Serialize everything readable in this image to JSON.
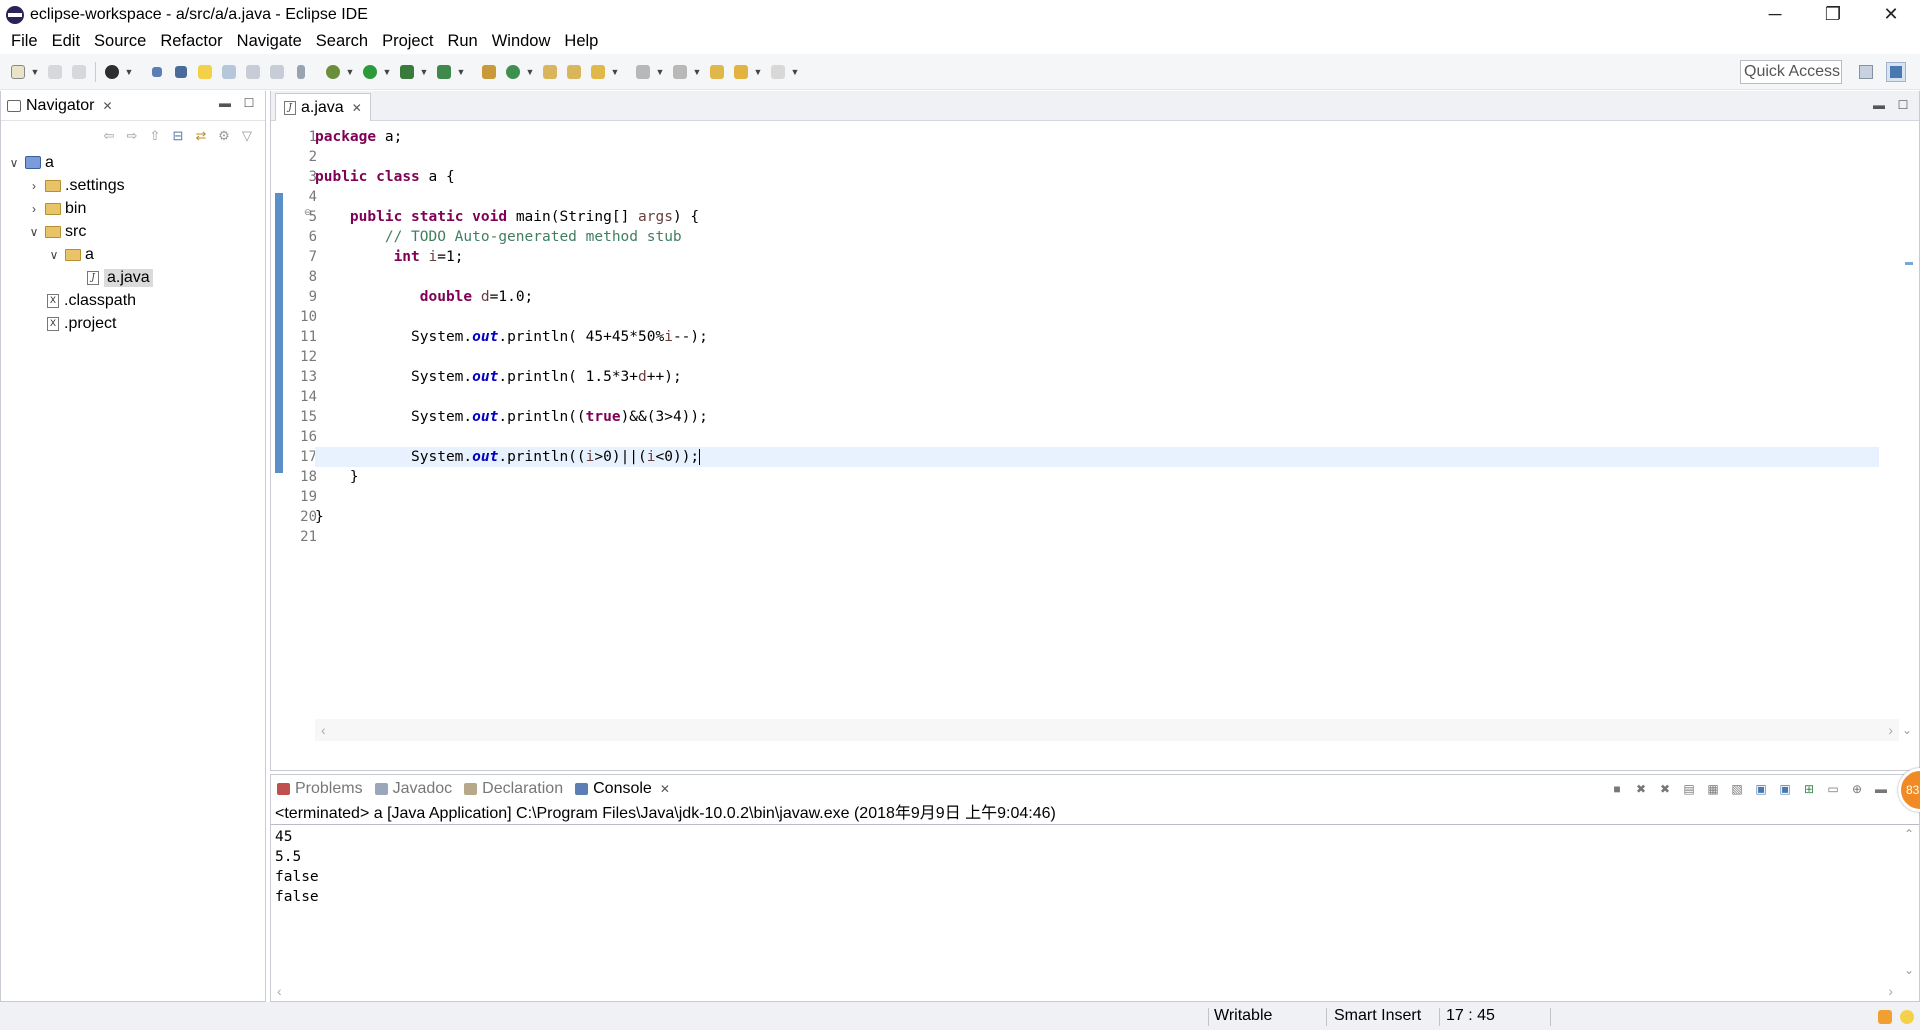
{
  "window": {
    "title": "eclipse-workspace - a/src/a/a.java - Eclipse IDE",
    "minimize": "─",
    "restore": "❐",
    "close": "✕"
  },
  "menu": [
    "File",
    "Edit",
    "Source",
    "Refactor",
    "Navigate",
    "Search",
    "Project",
    "Run",
    "Window",
    "Help"
  ],
  "toolbar": {
    "quick_access": "Quick Access"
  },
  "navigator": {
    "tab_label": "Navigator",
    "tree": [
      {
        "label": "a",
        "type": "project",
        "twisty": "∨",
        "indent": 0
      },
      {
        "label": ".settings",
        "type": "folder",
        "twisty": "›",
        "indent": 1
      },
      {
        "label": "bin",
        "type": "folder",
        "twisty": "›",
        "indent": 1
      },
      {
        "label": "src",
        "type": "folder",
        "twisty": "∨",
        "indent": 1
      },
      {
        "label": "a",
        "type": "folder",
        "twisty": "∨",
        "indent": 2
      },
      {
        "label": "a.java",
        "type": "java",
        "twisty": "",
        "indent": 3,
        "selected": true
      },
      {
        "label": ".classpath",
        "type": "file",
        "twisty": "",
        "indent": 1
      },
      {
        "label": ".project",
        "type": "file",
        "twisty": "",
        "indent": 1
      }
    ]
  },
  "editor": {
    "tab_label": "a.java",
    "line_numbers": [
      "1",
      "2",
      "3",
      "4",
      "5",
      "6",
      "7",
      "8",
      "9",
      "10",
      "11",
      "12",
      "13",
      "14",
      "15",
      "16",
      "17",
      "18",
      "19",
      "20",
      "21"
    ],
    "fold_marker": "⊖",
    "code_lines": [
      [
        {
          "t": "package",
          "c": "kw"
        },
        {
          "t": " a;",
          "c": ""
        }
      ],
      [],
      [
        {
          "t": "public",
          "c": "kw"
        },
        {
          "t": " ",
          "c": ""
        },
        {
          "t": "class",
          "c": "kw"
        },
        {
          "t": " a {",
          "c": ""
        }
      ],
      [],
      [
        {
          "t": "    ",
          "c": ""
        },
        {
          "t": "public",
          "c": "kw"
        },
        {
          "t": " ",
          "c": ""
        },
        {
          "t": "static",
          "c": "kw"
        },
        {
          "t": " ",
          "c": ""
        },
        {
          "t": "void",
          "c": "kw"
        },
        {
          "t": " main(String[] ",
          "c": ""
        },
        {
          "t": "args",
          "c": "vr"
        },
        {
          "t": ") {",
          "c": ""
        }
      ],
      [
        {
          "t": "        ",
          "c": ""
        },
        {
          "t": "// TODO Auto-generated method stub",
          "c": "cm"
        }
      ],
      [
        {
          "t": "         ",
          "c": ""
        },
        {
          "t": "int",
          "c": "kw"
        },
        {
          "t": " ",
          "c": ""
        },
        {
          "t": "i",
          "c": "vr"
        },
        {
          "t": "=1;",
          "c": ""
        }
      ],
      [],
      [
        {
          "t": "            ",
          "c": ""
        },
        {
          "t": "double",
          "c": "kw"
        },
        {
          "t": " ",
          "c": ""
        },
        {
          "t": "d",
          "c": "vr"
        },
        {
          "t": "=1.0;",
          "c": ""
        }
      ],
      [],
      [
        {
          "t": "           System.",
          "c": ""
        },
        {
          "t": "out",
          "c": "fld"
        },
        {
          "t": ".println( 45+45*50%",
          "c": ""
        },
        {
          "t": "i",
          "c": "vr"
        },
        {
          "t": "--);",
          "c": ""
        }
      ],
      [],
      [
        {
          "t": "           System.",
          "c": ""
        },
        {
          "t": "out",
          "c": "fld"
        },
        {
          "t": ".println( 1.5*3+",
          "c": ""
        },
        {
          "t": "d",
          "c": "vr"
        },
        {
          "t": "++);",
          "c": ""
        }
      ],
      [],
      [
        {
          "t": "           System.",
          "c": ""
        },
        {
          "t": "out",
          "c": "fld"
        },
        {
          "t": ".println((",
          "c": ""
        },
        {
          "t": "true",
          "c": "kw"
        },
        {
          "t": ")&&(3>4));",
          "c": ""
        }
      ],
      [],
      [
        {
          "t": "           System.",
          "c": ""
        },
        {
          "t": "out",
          "c": "fld"
        },
        {
          "t": ".println((",
          "c": ""
        },
        {
          "t": "i",
          "c": "vr"
        },
        {
          "t": ">0)||(",
          "c": ""
        },
        {
          "t": "i",
          "c": "vr"
        },
        {
          "t": "<0));",
          "c": ""
        }
      ],
      [
        {
          "t": "    }",
          "c": ""
        }
      ],
      [],
      [
        {
          "t": "}",
          "c": ""
        }
      ],
      []
    ],
    "current_line_index": 16
  },
  "console": {
    "tabs": [
      {
        "label": "Problems",
        "active": false,
        "color": "#c0504d"
      },
      {
        "label": "Javadoc",
        "active": false,
        "color": "#9aa7b8"
      },
      {
        "label": "Declaration",
        "active": false,
        "color": "#b8a88a"
      },
      {
        "label": "Console",
        "active": true,
        "color": "#5b7fb4"
      }
    ],
    "status": "<terminated> a [Java Application] C:\\Program Files\\Java\\jdk-10.0.2\\bin\\javaw.exe (2018年9月9日 上午9:04:46)",
    "output": [
      "45",
      "5.5",
      "false",
      "false"
    ],
    "badge": "83"
  },
  "statusbar": {
    "writable": "Writable",
    "insert_mode": "Smart Insert",
    "position": "17 : 45"
  },
  "colors": {
    "keyword": "#7f0055",
    "comment": "#3f7f5f",
    "field": "#0000c0",
    "current_line": "#e8f2fe"
  }
}
